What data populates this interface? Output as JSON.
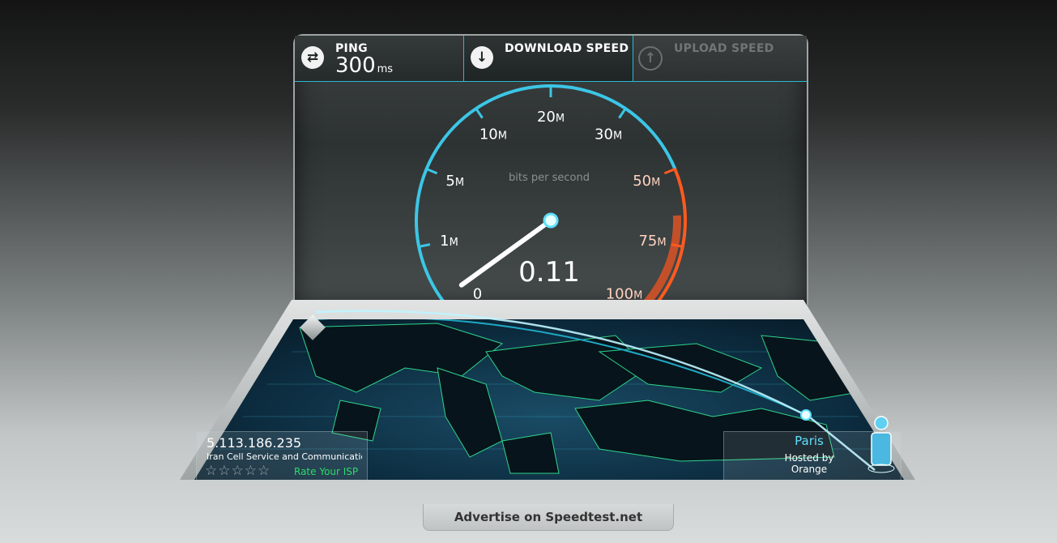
{
  "ping": {
    "label": "PING",
    "value": "300",
    "unit": "ms"
  },
  "download": {
    "label": "DOWNLOAD SPEED"
  },
  "upload": {
    "label": "UPLOAD SPEED"
  },
  "gauge": {
    "unit_caption": "bits per second",
    "current_value": "0.11",
    "needle_value_mbps": 0.11,
    "ticks": [
      {
        "num": "0",
        "suffix": ""
      },
      {
        "num": "1",
        "suffix": "M"
      },
      {
        "num": "5",
        "suffix": "M"
      },
      {
        "num": "10",
        "suffix": "M"
      },
      {
        "num": "20",
        "suffix": "M"
      },
      {
        "num": "30",
        "suffix": "M"
      },
      {
        "num": "50",
        "suffix": "M"
      },
      {
        "num": "75",
        "suffix": "M"
      },
      {
        "num": "100",
        "suffix": "M"
      }
    ],
    "colors": {
      "normal": "#3cc6e6",
      "high": "#ff5a1f",
      "needle": "#ffffff"
    }
  },
  "client": {
    "ip": "5.113.186.235",
    "isp": "Iran Cell Service and Communication",
    "stars_display": "☆☆☆☆☆",
    "rate_label": "Rate Your ISP"
  },
  "server": {
    "city": "Paris",
    "hosted_by_label": "Hosted by",
    "host": "Orange"
  },
  "footer": {
    "advertise_label": "Advertise on Speedtest.net"
  }
}
